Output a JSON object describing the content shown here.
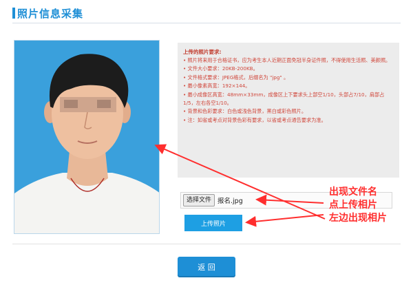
{
  "header": {
    "title": "照片信息采集"
  },
  "requirements": {
    "title": "上传的照片要求:",
    "items": [
      "• 照片将来用于合格证书，应为考生本人近期正面免冠半身证件照，不得使用生活照、美颜照。",
      "• 文件大小要求：20KB-200KB。",
      "• 文件格式要求：JPEG格式，后缀名为 \"jpg\" 。",
      "• 最小像素高宽：192×144。",
      "• 最小成像区高宽：48mm×33mm，成像区上下要求头上部空1/10，头部占7/10，肩部占1/5，左右各空1/10。",
      "• 背景和色彩要求：白色或浅色背景，黑白或彩色照片。",
      "• 注：如省或考点对背景色彩有要求，以省或考点通告要求为准。"
    ]
  },
  "upload": {
    "choose_file_label": "选择文件",
    "file_name": "报名.jpg",
    "upload_button_label": "上传照片"
  },
  "annotations": [
    "出现文件名",
    "点上传相片",
    "左边出现相片"
  ],
  "footer": {
    "back_button_label": "返 回"
  },
  "colors": {
    "accent": "#1e8fd6",
    "button": "#1e9fe3",
    "annotation": "#ff2e2e",
    "photo_background": "#3aa0dc"
  }
}
